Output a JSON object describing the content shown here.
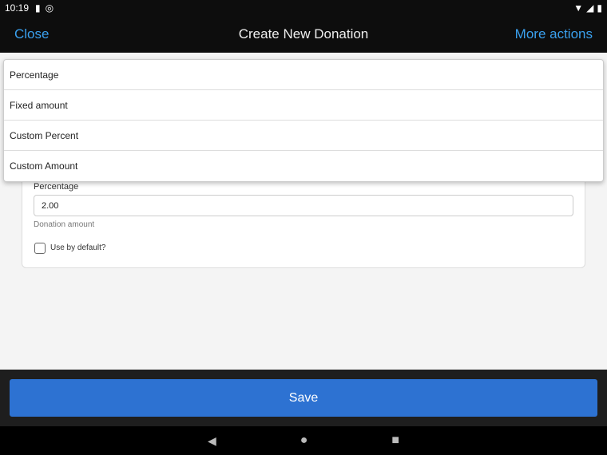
{
  "status_bar": {
    "time": "10:19",
    "icons": [
      "sim-card-icon",
      "data-saver-icon",
      "wifi-icon",
      "signal-icon",
      "battery-icon"
    ]
  },
  "header": {
    "close_label": "Close",
    "title": "Create New Donation",
    "more_label": "More actions",
    "accent": "#3aa0ee"
  },
  "form": {
    "field_label": "Percentage",
    "field_value": "2.00",
    "help_text": "Donation amount",
    "checkbox_label": "Use by default?",
    "checkbox_checked": false
  },
  "dropdown": {
    "options": [
      "Percentage",
      "Fixed amount",
      "Custom Percent",
      "Custom Amount"
    ]
  },
  "footer": {
    "save_label": "Save",
    "save_color": "#2d72d2"
  },
  "nav": {
    "icons": [
      "back-icon",
      "home-icon",
      "recents-icon"
    ]
  }
}
